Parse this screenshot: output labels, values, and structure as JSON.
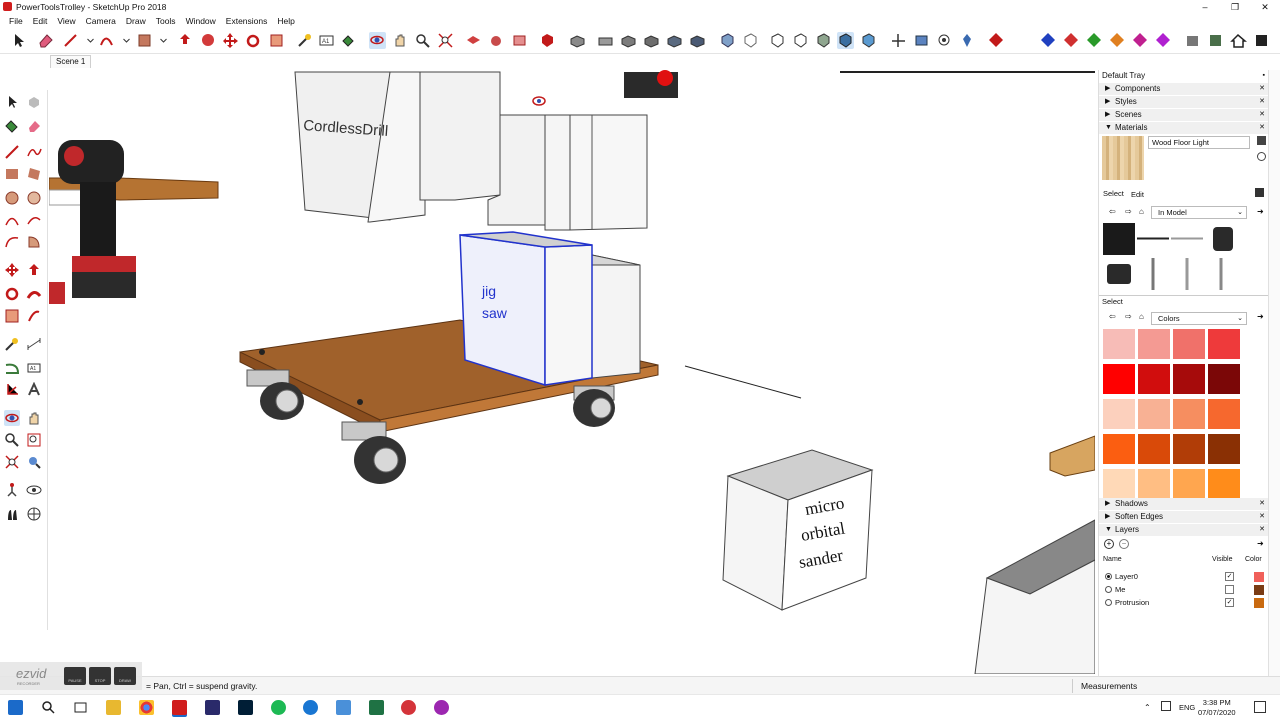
{
  "window": {
    "title": "PowerToolsTrolley - SketchUp Pro 2018",
    "controls": [
      "–",
      "❐",
      "✕"
    ]
  },
  "menu": [
    "File",
    "Edit",
    "View",
    "Camera",
    "Draw",
    "Tools",
    "Window",
    "Extensions",
    "Help"
  ],
  "scene_tab": "Scene 1",
  "viewport": {
    "labels": {
      "cordless_drill": "CordlessDrill",
      "jig": "jig",
      "saw": "saw",
      "micro": "micro",
      "orbital": "orbital",
      "sander": "sander"
    }
  },
  "tray": {
    "title": "Default Tray",
    "sections": [
      "Components",
      "Styles",
      "Scenes",
      "Materials"
    ],
    "material_name": "Wood Floor Light",
    "select_tab": "Select",
    "edit_tab": "Edit",
    "collection_select": "In Model",
    "select_label": "Select",
    "colors_select": "Colors",
    "swatches": [
      [
        "#f7bcb7",
        "#f49a93",
        "#f0716a",
        "#ee3a3b"
      ],
      [
        "#ff0000",
        "#d10d0d",
        "#a60b0b",
        "#7b0707"
      ],
      [
        "#fcd0bd",
        "#f8b194",
        "#f68e60",
        "#f6682e"
      ],
      [
        "#fb5e11",
        "#d94a09",
        "#b13d07",
        "#8a3004"
      ],
      [
        "#ffd9b7",
        "#ffbe83",
        "#ffa64f",
        "#ff8c1a"
      ]
    ],
    "bottom_sections": [
      "Shadows",
      "Soften Edges",
      "Layers"
    ],
    "layers_header": {
      "name": "Name",
      "visible": "Visible",
      "color": "Color"
    },
    "layers": [
      {
        "name": "Layer0",
        "active": true,
        "visible": true,
        "color": "#f0605a"
      },
      {
        "name": "Me",
        "active": false,
        "visible": false,
        "color": "#7a3c14"
      },
      {
        "name": "Protrusion",
        "active": false,
        "visible": true,
        "color": "#c96a10"
      }
    ]
  },
  "status": {
    "hint": "= Pan, Ctrl = suspend gravity.",
    "measurements": "Measurements"
  },
  "ezvid": {
    "logo": "ezvid",
    "sub": "RECORDER",
    "buttons": [
      "PAUSE",
      "STOP",
      "DRAW"
    ]
  },
  "taskbar": {
    "lang": "ENG",
    "time": "3:38 PM",
    "date": "07/07/2020"
  },
  "colors": {
    "accent_red": "#d01d1d",
    "wood": "#a0612b",
    "selection": "#2233cc"
  }
}
